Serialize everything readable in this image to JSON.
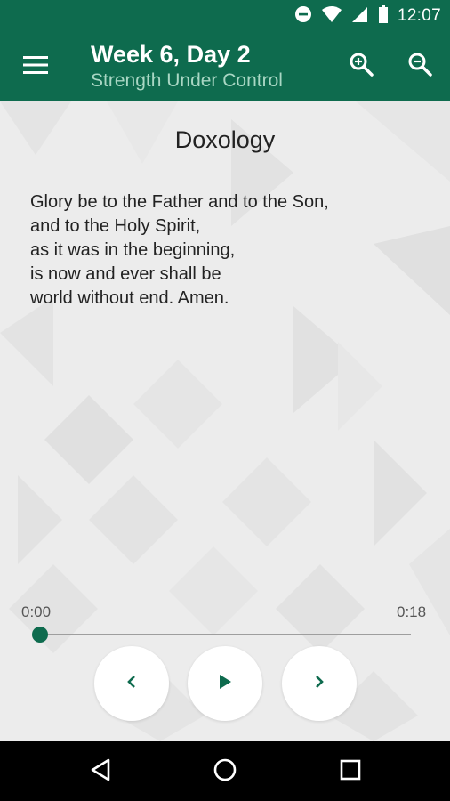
{
  "status_bar": {
    "time": "12:07",
    "icons": [
      "do-not-disturb-icon",
      "wifi-icon",
      "cellular-signal-icon",
      "battery-icon"
    ]
  },
  "app_bar": {
    "title": "Week 6, Day 2",
    "subtitle": "Strength Under Control",
    "icons": [
      "menu-icon",
      "zoom-in-icon",
      "zoom-out-icon"
    ]
  },
  "content": {
    "heading": "Doxology",
    "lines": [
      "Glory be to the Father and to the Son,",
      "and to the Holy Spirit,",
      "as it was in the beginning,",
      "is now and ever shall be",
      "world without end. Amen."
    ]
  },
  "player": {
    "current_time": "0:00",
    "total_time": "0:18",
    "progress": 0,
    "controls": [
      "previous-icon",
      "play-icon",
      "next-icon"
    ]
  },
  "nav_bar": {
    "icons": [
      "back-icon",
      "home-icon",
      "recents-icon"
    ]
  },
  "colors": {
    "primary": "#0e6b4e",
    "subtitle": "#a9d7c4",
    "background": "#ececec"
  }
}
